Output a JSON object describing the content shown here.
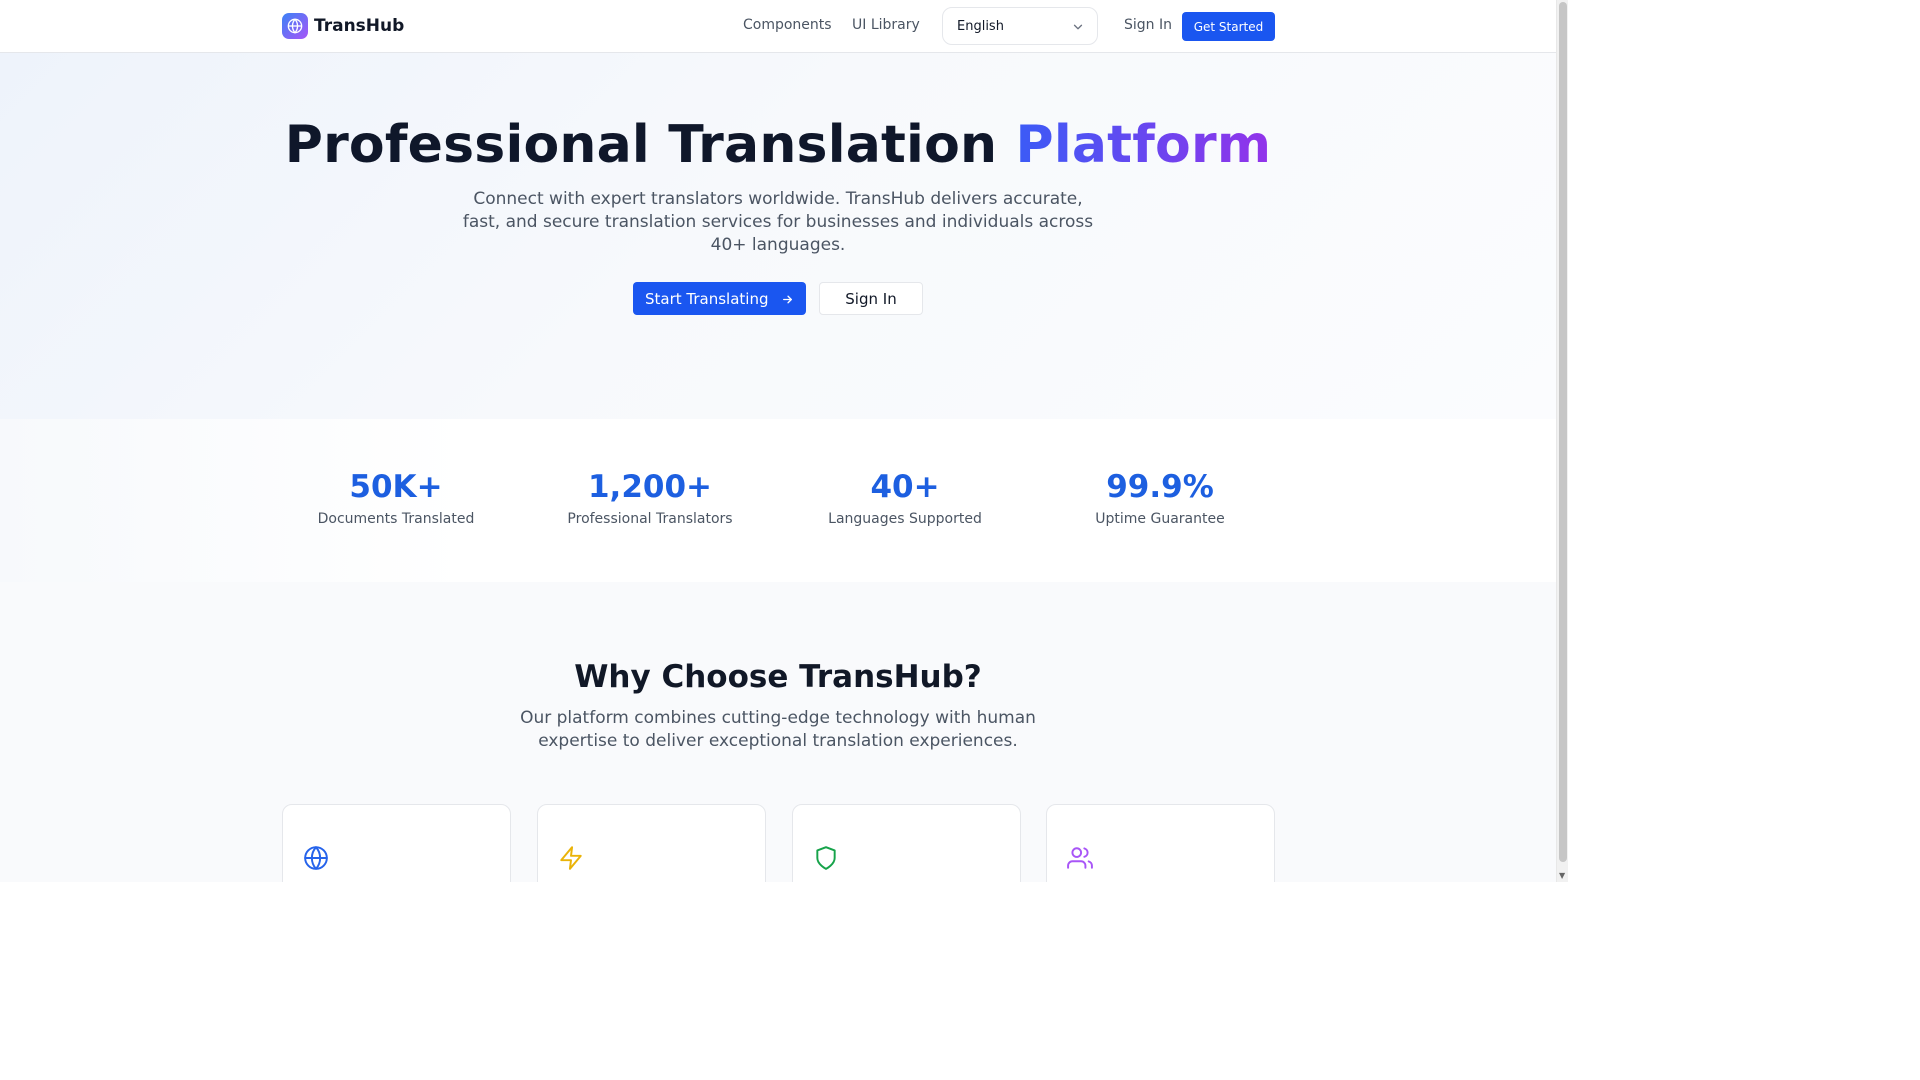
{
  "header": {
    "brand": "TransHub",
    "nav": [
      "Components",
      "UI Library"
    ],
    "language": "English",
    "signin": "Sign In",
    "get_started": "Get Started"
  },
  "hero": {
    "title_main": "Professional Translation",
    "title_accent": "Platform",
    "subtitle": "Connect with expert translators worldwide. TransHub delivers accurate, fast, and secure translation services for businesses and individuals across 40+ languages.",
    "cta_primary": "Start Translating",
    "cta_secondary": "Sign In"
  },
  "stats": [
    {
      "value": "50K+",
      "label": "Documents Translated"
    },
    {
      "value": "1,200+",
      "label": "Professional Translators"
    },
    {
      "value": "40+",
      "label": "Languages Supported"
    },
    {
      "value": "99.9%",
      "label": "Uptime Guarantee"
    }
  ],
  "why": {
    "title": "Why Choose TransHub?",
    "subtitle": "Our platform combines cutting-edge technology with human expertise to deliver exceptional translation experiences.",
    "cards": [
      {
        "icon": "globe-icon",
        "color": "#2563eb"
      },
      {
        "icon": "lightning-icon",
        "color": "#eab308"
      },
      {
        "icon": "shield-icon",
        "color": "#16a34a"
      },
      {
        "icon": "users-icon",
        "color": "#a855f7"
      }
    ]
  },
  "colors": {
    "primary": "#1a56f0",
    "stat_blue": "#1d5fe0",
    "accent_gradient_start": "#3b5bf6",
    "accent_gradient_end": "#9333ea"
  }
}
